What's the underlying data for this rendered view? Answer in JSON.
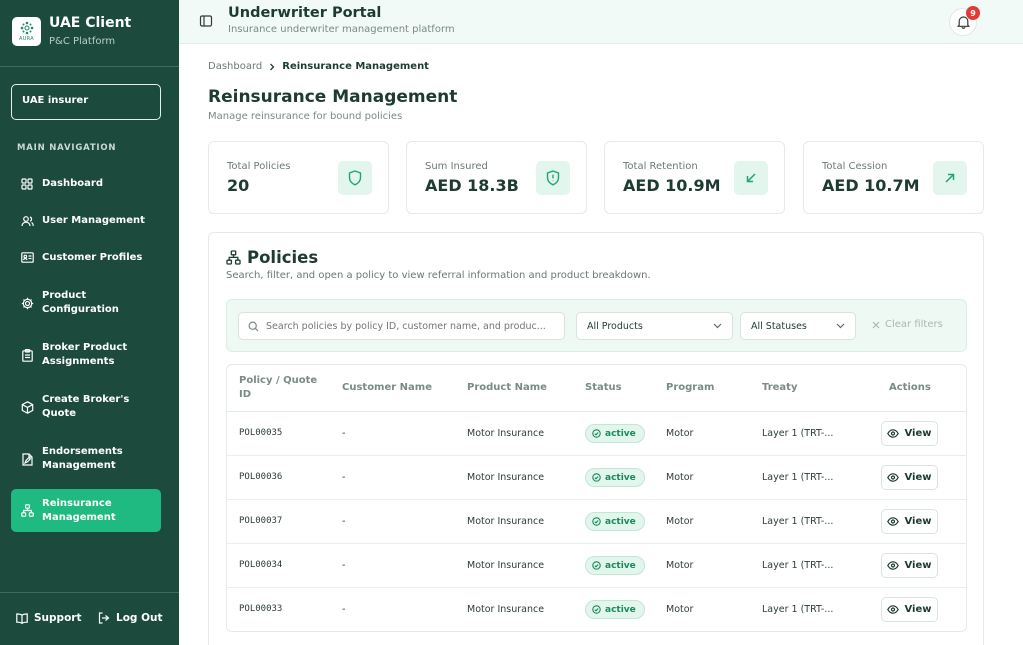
{
  "brand": {
    "title": "UAE Client",
    "subtitle": "P&C Platform",
    "logo_text": "AURA"
  },
  "tenant": {
    "label": "UAE insurer"
  },
  "nav": {
    "heading": "MAIN NAVIGATION",
    "items": [
      {
        "label": "Dashboard",
        "icon": "grid-icon"
      },
      {
        "label": "User Management",
        "icon": "users-icon"
      },
      {
        "label": "Customer Profiles",
        "icon": "id-card-icon"
      },
      {
        "label": "Product Configuration",
        "icon": "gear-icon"
      },
      {
        "label": "Broker Product Assignments",
        "icon": "clipboard-icon"
      },
      {
        "label": "Create Broker's Quote",
        "icon": "package-icon"
      },
      {
        "label": "Endorsements Management",
        "icon": "file-edit-icon"
      },
      {
        "label": "Reinsurance Management",
        "icon": "network-icon",
        "active": true
      }
    ],
    "support_label": "Support",
    "logout_label": "Log Out"
  },
  "header": {
    "title": "Underwriter Portal",
    "subtitle": "Insurance underwriter management platform",
    "notification_count": "9"
  },
  "breadcrumb": {
    "root": "Dashboard",
    "current": "Reinsurance Management"
  },
  "page": {
    "title": "Reinsurance Management",
    "subtitle": "Manage reinsurance for bound policies"
  },
  "stats": [
    {
      "label": "Total Policies",
      "value": "20",
      "icon": "shield-icon"
    },
    {
      "label": "Sum Insured",
      "value": "AED 18.3B",
      "icon": "shield-alert-icon"
    },
    {
      "label": "Total Retention",
      "value": "AED 10.9M",
      "icon": "arrow-down-left-icon"
    },
    {
      "label": "Total Cession",
      "value": "AED 10.7M",
      "icon": "arrow-up-right-icon"
    }
  ],
  "policies": {
    "title": "Policies",
    "subtitle": "Search, filter, and open a policy to view referral information and product breakdown.",
    "search_placeholder": "Search policies by policy ID, customer name, and produc...",
    "product_filter": "All Products",
    "status_filter": "All Statuses",
    "clear_label": "Clear filters",
    "columns": [
      "Policy / Quote ID",
      "Customer Name",
      "Product Name",
      "Status",
      "Program",
      "Treaty",
      "Actions"
    ],
    "view_label": "View",
    "rows": [
      {
        "id": "POL00035",
        "customer": "-",
        "product": "Motor Insurance",
        "status": "active",
        "program": "Motor",
        "treaty": "Layer 1 (TRT-..."
      },
      {
        "id": "POL00036",
        "customer": "-",
        "product": "Motor Insurance",
        "status": "active",
        "program": "Motor",
        "treaty": "Layer 1 (TRT-..."
      },
      {
        "id": "POL00037",
        "customer": "-",
        "product": "Motor Insurance",
        "status": "active",
        "program": "Motor",
        "treaty": "Layer 1 (TRT-..."
      },
      {
        "id": "POL00034",
        "customer": "-",
        "product": "Motor Insurance",
        "status": "active",
        "program": "Motor",
        "treaty": "Layer 1 (TRT-..."
      },
      {
        "id": "POL00033",
        "customer": "-",
        "product": "Motor Insurance",
        "status": "active",
        "program": "Motor",
        "treaty": "Layer 1 (TRT-..."
      }
    ]
  },
  "colors": {
    "sidebar": "#1c4a3c",
    "accent": "#1fba82",
    "badge": "#e53935"
  }
}
